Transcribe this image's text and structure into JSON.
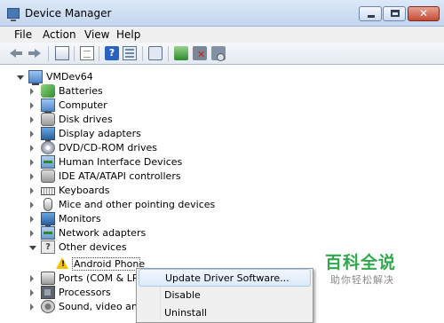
{
  "window": {
    "title": "Device Manager",
    "controls": {
      "close_glyph": "✕"
    }
  },
  "menubar": {
    "items": [
      "File",
      "Action",
      "View",
      "Help"
    ]
  },
  "toolbar": {
    "buttons": [
      "back",
      "forward",
      "show-hide-console-tree",
      "properties",
      "help",
      "show-hide-action-pane",
      "scan-for-hardware-changes",
      "update-driver",
      "disable",
      "uninstall"
    ],
    "help_glyph": "?"
  },
  "tree": {
    "root": "VMDev64",
    "categories": [
      {
        "label": "Batteries",
        "icon": "battery-icon"
      },
      {
        "label": "Computer",
        "icon": "computer-icon"
      },
      {
        "label": "Disk drives",
        "icon": "disk-drive-icon"
      },
      {
        "label": "Display adapters",
        "icon": "display-adapter-icon"
      },
      {
        "label": "DVD/CD-ROM drives",
        "icon": "dvd-icon"
      },
      {
        "label": "Human Interface Devices",
        "icon": "hid-icon"
      },
      {
        "label": "IDE ATA/ATAPI controllers",
        "icon": "ide-controller-icon"
      },
      {
        "label": "Keyboards",
        "icon": "keyboard-icon"
      },
      {
        "label": "Mice and other pointing devices",
        "icon": "mouse-icon"
      },
      {
        "label": "Monitors",
        "icon": "monitor-icon"
      },
      {
        "label": "Network adapters",
        "icon": "network-adapter-icon"
      },
      {
        "label": "Other devices",
        "icon": "other-devices-icon",
        "expanded": true
      },
      {
        "label": "Ports (COM & LPT",
        "icon": "port-icon"
      },
      {
        "label": "Processors",
        "icon": "processor-icon"
      },
      {
        "label": "Sound, video and",
        "icon": "sound-icon"
      }
    ],
    "other_devices_children": [
      {
        "label": "Android Phone",
        "icon": "warning-icon",
        "selected": true
      }
    ],
    "question_glyph": "?",
    "warning_glyph": "!"
  },
  "context_menu": {
    "items": [
      "Update Driver Software...",
      "Disable",
      "Uninstall"
    ],
    "highlighted_index": 0
  },
  "watermark": {
    "text": "百科全说",
    "subtext": "助你轻松解决"
  },
  "colors": {
    "selection_border": "#444444",
    "menu_highlight": "#dceaf9",
    "watermark_green": "#2fa84b",
    "warning_yellow": "#f2c200"
  }
}
